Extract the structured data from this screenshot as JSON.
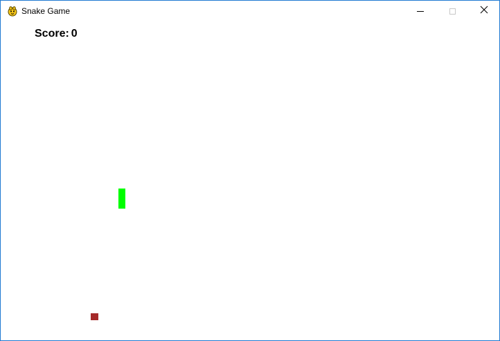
{
  "window": {
    "title": "Snake Game",
    "icon": "pygame-snake-icon",
    "controls": [
      "minimize-icon",
      "maximize-icon",
      "close-icon"
    ]
  },
  "game": {
    "score_label": "Score:",
    "score_value": "0",
    "snake_color": "#00ff00",
    "food_color": "#a52a2a",
    "background_color": "#ffffff"
  }
}
